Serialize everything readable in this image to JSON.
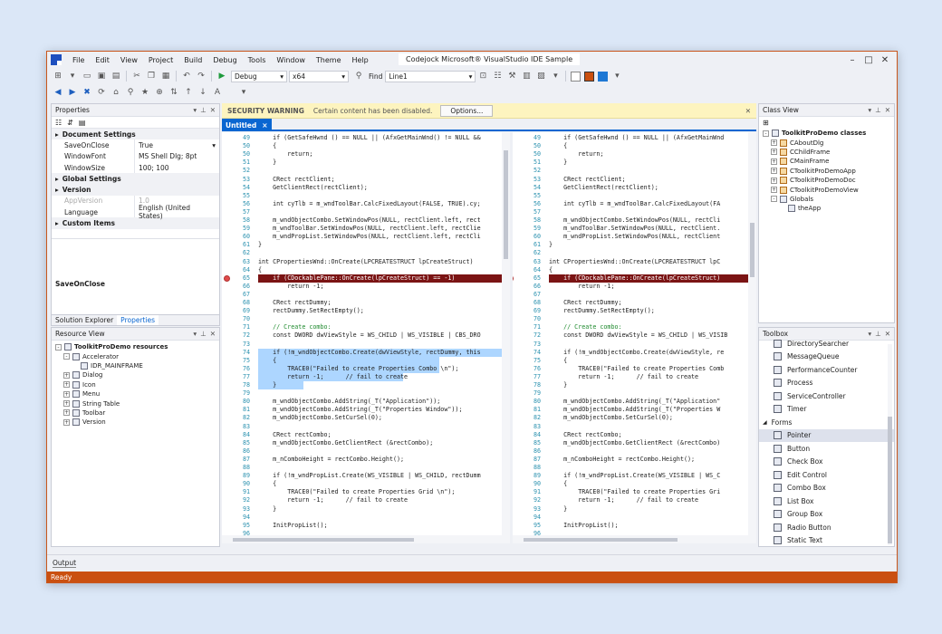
{
  "window": {
    "title": "Codejock Microsoft® VisualStudio IDE Sample",
    "status": "Ready",
    "accent": "#ca5010"
  },
  "menu": [
    "File",
    "Edit",
    "View",
    "Project",
    "Build",
    "Debug",
    "Tools",
    "Window",
    "Theme",
    "Help"
  ],
  "toolbar": {
    "config_combo": "Debug",
    "platform_combo": "x64",
    "find_label": "Find",
    "find_combo": "Line1"
  },
  "properties_panel": {
    "title": "Properties",
    "rows": [
      {
        "kind": "cat",
        "name": "Document Settings",
        "value": ""
      },
      {
        "kind": "prop",
        "name": "SaveOnClose",
        "value": "True",
        "dim": false
      },
      {
        "kind": "prop",
        "name": "WindowFont",
        "value": "MS Shell Dlg; 8pt",
        "dim": false
      },
      {
        "kind": "prop",
        "name": "WindowSize",
        "value": "100; 100",
        "dim": false
      },
      {
        "kind": "cat",
        "name": "Global Settings",
        "value": ""
      },
      {
        "kind": "cat",
        "name": "Version",
        "value": ""
      },
      {
        "kind": "prop",
        "name": "AppVersion",
        "value": "1.0",
        "dim": true
      },
      {
        "kind": "prop",
        "name": "Language",
        "value": "English (United States)",
        "dim": false
      },
      {
        "kind": "cat",
        "name": "Custom Items",
        "value": ""
      }
    ],
    "description_title": "SaveOnClose",
    "tabs": [
      "Solution Explorer",
      "Properties"
    ]
  },
  "resource_view": {
    "title": "Resource View",
    "items": [
      {
        "level": 0,
        "label": "ToolkitProDemo resources",
        "expander": "-",
        "bold": true
      },
      {
        "level": 1,
        "label": "Accelerator",
        "expander": "-",
        "bold": false
      },
      {
        "level": 2,
        "label": "IDR_MAINFRAME",
        "expander": "",
        "bold": false
      },
      {
        "level": 1,
        "label": "Dialog",
        "expander": "+",
        "bold": false
      },
      {
        "level": 1,
        "label": "Icon",
        "expander": "+",
        "bold": false
      },
      {
        "level": 1,
        "label": "Menu",
        "expander": "+",
        "bold": false
      },
      {
        "level": 1,
        "label": "String Table",
        "expander": "+",
        "bold": false
      },
      {
        "level": 1,
        "label": "Toolbar",
        "expander": "+",
        "bold": false
      },
      {
        "level": 1,
        "label": "Version",
        "expander": "+",
        "bold": false
      }
    ]
  },
  "warning": {
    "title": "SECURITY WARNING",
    "message": "Certain content has been disabled.",
    "button": "Options..."
  },
  "doc_tab": {
    "label": "Untitled",
    "close": "×"
  },
  "code": {
    "left": [
      {
        "n": "49",
        "t": "    if (GetSafeHwnd () == NULL || (AfxGetMainWnd() != NULL &&"
      },
      {
        "n": "50",
        "t": "    {"
      },
      {
        "n": "50",
        "t": "        return;"
      },
      {
        "n": "51",
        "t": "    }"
      },
      {
        "n": "52",
        "t": ""
      },
      {
        "n": "53",
        "t": "    CRect rectClient;"
      },
      {
        "n": "54",
        "t": "    GetClientRect(rectClient);"
      },
      {
        "n": "55",
        "t": ""
      },
      {
        "n": "56",
        "t": "    int cyTlb = m_wndToolBar.CalcFixedLayout(FALSE, TRUE).cy;"
      },
      {
        "n": "57",
        "t": ""
      },
      {
        "n": "58",
        "t": "    m_wndObjectCombo.SetWindowPos(NULL, rectClient.left, rect"
      },
      {
        "n": "59",
        "t": "    m_wndToolBar.SetWindowPos(NULL, rectClient.left, rectClie"
      },
      {
        "n": "60",
        "t": "    m_wndPropList.SetWindowPos(NULL, rectClient.left, rectCli"
      },
      {
        "n": "61",
        "t": "}"
      },
      {
        "n": "62",
        "t": ""
      },
      {
        "n": "63",
        "t": "int CPropertiesWnd::OnCreate(LPCREATESTRUCT lpCreateStruct)"
      },
      {
        "n": "64",
        "t": "{"
      },
      {
        "n": "65",
        "t": "    if (CDockablePane::OnCreate(lpCreateStruct) == -1)"
      },
      {
        "n": "66",
        "t": "        return -1;"
      },
      {
        "n": "67",
        "t": ""
      },
      {
        "n": "68",
        "t": "    CRect rectDummy;"
      },
      {
        "n": "69",
        "t": "    rectDummy.SetRectEmpty();"
      },
      {
        "n": "70",
        "t": ""
      },
      {
        "n": "71",
        "t": "    // Create combo:"
      },
      {
        "n": "72",
        "t": "    const DWORD dwViewStyle = WS_CHILD | WS_VISIBLE | CBS_DRO"
      },
      {
        "n": "73",
        "t": ""
      },
      {
        "n": "74",
        "t": "    if (!m_wndObjectCombo.Create(dwViewStyle, rectDummy, this"
      },
      {
        "n": "75",
        "t": "    {"
      },
      {
        "n": "76",
        "t": "        TRACE0(\"Failed to create Properties Combo \\n\");"
      },
      {
        "n": "77",
        "t": "        return -1;      // fail to create"
      },
      {
        "n": "78",
        "t": "    }"
      },
      {
        "n": "79",
        "t": ""
      },
      {
        "n": "80",
        "t": "    m_wndObjectCombo.AddString(_T(\"Application\"));"
      },
      {
        "n": "81",
        "t": "    m_wndObjectCombo.AddString(_T(\"Properties Window\"));"
      },
      {
        "n": "82",
        "t": "    m_wndObjectCombo.SetCurSel(0);"
      },
      {
        "n": "83",
        "t": ""
      },
      {
        "n": "84",
        "t": "    CRect rectCombo;"
      },
      {
        "n": "85",
        "t": "    m_wndObjectCombo.GetClientRect (&rectCombo);"
      },
      {
        "n": "86",
        "t": ""
      },
      {
        "n": "87",
        "t": "    m_nComboHeight = rectCombo.Height();"
      },
      {
        "n": "88",
        "t": ""
      },
      {
        "n": "89",
        "t": "    if (!m_wndPropList.Create(WS_VISIBLE | WS_CHILD, rectDumm"
      },
      {
        "n": "90",
        "t": "    {"
      },
      {
        "n": "91",
        "t": "        TRACE0(\"Failed to create Properties Grid \\n\");"
      },
      {
        "n": "92",
        "t": "        return -1;      // fail to create"
      },
      {
        "n": "93",
        "t": "    }"
      },
      {
        "n": "94",
        "t": ""
      },
      {
        "n": "95",
        "t": "    InitPropList();"
      },
      {
        "n": "96",
        "t": ""
      }
    ],
    "right": [
      {
        "n": "49",
        "t": "    if (GetSafeHwnd () == NULL || (AfxGetMainWnd"
      },
      {
        "n": "50",
        "t": "    {"
      },
      {
        "n": "50",
        "t": "        return;"
      },
      {
        "n": "51",
        "t": "    }"
      },
      {
        "n": "52",
        "t": ""
      },
      {
        "n": "53",
        "t": "    CRect rectClient;"
      },
      {
        "n": "54",
        "t": "    GetClientRect(rectClient);"
      },
      {
        "n": "55",
        "t": ""
      },
      {
        "n": "56",
        "t": "    int cyTlb = m_wndToolBar.CalcFixedLayout(FA"
      },
      {
        "n": "57",
        "t": ""
      },
      {
        "n": "58",
        "t": "    m_wndObjectCombo.SetWindowPos(NULL, rectCli"
      },
      {
        "n": "59",
        "t": "    m_wndToolBar.SetWindowPos(NULL, rectClient."
      },
      {
        "n": "60",
        "t": "    m_wndPropList.SetWindowPos(NULL, rectClient"
      },
      {
        "n": "61",
        "t": "}"
      },
      {
        "n": "62",
        "t": ""
      },
      {
        "n": "63",
        "t": "int CPropertiesWnd::OnCreate(LPCREATESTRUCT lpC"
      },
      {
        "n": "64",
        "t": "{"
      },
      {
        "n": "65",
        "t": "    if (CDockablePane::OnCreate(lpCreateStruct)"
      },
      {
        "n": "66",
        "t": "        return -1;"
      },
      {
        "n": "67",
        "t": ""
      },
      {
        "n": "68",
        "t": "    CRect rectDummy;"
      },
      {
        "n": "69",
        "t": "    rectDummy.SetRectEmpty();"
      },
      {
        "n": "70",
        "t": ""
      },
      {
        "n": "71",
        "t": "    // Create combo:"
      },
      {
        "n": "72",
        "t": "    const DWORD dwViewStyle = WS_CHILD | WS_VISIB"
      },
      {
        "n": "73",
        "t": ""
      },
      {
        "n": "74",
        "t": "    if (!m_wndObjectCombo.Create(dwViewStyle, re"
      },
      {
        "n": "75",
        "t": "    {"
      },
      {
        "n": "76",
        "t": "        TRACE0(\"Failed to create Properties Comb"
      },
      {
        "n": "77",
        "t": "        return -1;      // fail to create"
      },
      {
        "n": "78",
        "t": "    }"
      },
      {
        "n": "79",
        "t": ""
      },
      {
        "n": "80",
        "t": "    m_wndObjectCombo.AddString(_T(\"Application\""
      },
      {
        "n": "81",
        "t": "    m_wndObjectCombo.AddString(_T(\"Properties W"
      },
      {
        "n": "82",
        "t": "    m_wndObjectCombo.SetCurSel(0);"
      },
      {
        "n": "83",
        "t": ""
      },
      {
        "n": "84",
        "t": "    CRect rectCombo;"
      },
      {
        "n": "85",
        "t": "    m_wndObjectCombo.GetClientRect (&rectCombo)"
      },
      {
        "n": "86",
        "t": ""
      },
      {
        "n": "87",
        "t": "    m_nComboHeight = rectCombo.Height();"
      },
      {
        "n": "88",
        "t": ""
      },
      {
        "n": "89",
        "t": "    if (!m_wndPropList.Create(WS_VISIBLE | WS_C"
      },
      {
        "n": "90",
        "t": "    {"
      },
      {
        "n": "91",
        "t": "        TRACE0(\"Failed to create Properties Gri"
      },
      {
        "n": "92",
        "t": "        return -1;      // fail to create"
      },
      {
        "n": "93",
        "t": "    }"
      },
      {
        "n": "94",
        "t": ""
      },
      {
        "n": "95",
        "t": "    InitPropList();"
      },
      {
        "n": "96",
        "t": ""
      }
    ]
  },
  "class_view": {
    "title": "Class View",
    "items": [
      {
        "level": 0,
        "label": "ToolkitProDemo classes",
        "expander": "-",
        "bold": true,
        "cls": false
      },
      {
        "level": 1,
        "label": "CAboutDlg",
        "expander": "+",
        "bold": false,
        "cls": true
      },
      {
        "level": 1,
        "label": "CChildFrame",
        "expander": "+",
        "bold": false,
        "cls": true
      },
      {
        "level": 1,
        "label": "CMainFrame",
        "expander": "+",
        "bold": false,
        "cls": true
      },
      {
        "level": 1,
        "label": "CToolkitProDemoApp",
        "expander": "+",
        "bold": false,
        "cls": true
      },
      {
        "level": 1,
        "label": "CToolkitProDemoDoc",
        "expander": "+",
        "bold": false,
        "cls": true
      },
      {
        "level": 1,
        "label": "CToolkitProDemoView",
        "expander": "+",
        "bold": false,
        "cls": true
      },
      {
        "level": 1,
        "label": "Globals",
        "expander": "-",
        "bold": false,
        "cls": false
      },
      {
        "level": 2,
        "label": "theApp",
        "expander": "",
        "bold": false,
        "cls": false
      }
    ]
  },
  "toolbox": {
    "title": "Toolbox",
    "items_top": [
      "DirectorySearcher",
      "MessageQueue",
      "PerformanceCounter",
      "Process",
      "ServiceController",
      "Timer"
    ],
    "section": "Forms",
    "items_forms": [
      "Pointer",
      "Button",
      "Check Box",
      "Edit Control",
      "Combo Box",
      "List Box",
      "Group Box",
      "Radio Button",
      "Static Text"
    ],
    "selected": "Pointer"
  },
  "output": {
    "label": "Output"
  }
}
